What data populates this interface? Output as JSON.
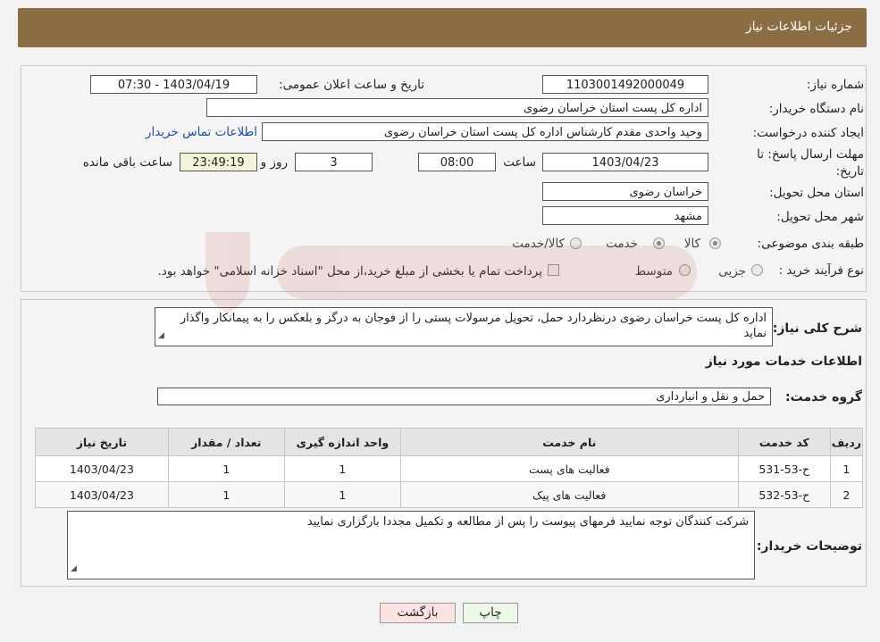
{
  "header": {
    "title": "جزئیات اطلاعات نیاز"
  },
  "form": {
    "need_number_label": "شماره نیاز:",
    "need_number": "1103001492000049",
    "announce_label": "تاریخ و ساعت اعلان عمومی:",
    "announce_value": "1403/04/19 - 07:30",
    "buyer_label": "نام دستگاه خریدار:",
    "buyer_value": "اداره کل پست استان خراسان رضوی",
    "creator_label": "ایجاد کننده درخواست:",
    "creator_value": "وحید واحدی مقدم کارشناس اداره کل پست استان خراسان رضوی",
    "contact_link": "اطلاعات تماس خریدار",
    "deadline_label_1": "مهلت ارسال پاسخ: تا",
    "deadline_label_2": "تاریخ:",
    "deadline_date": "1403/04/23",
    "time_label": "ساعت",
    "deadline_time": "08:00",
    "days_value": "3",
    "days_label": "روز و",
    "remaining_value": "23:49:19",
    "remaining_label": "ساعت باقی مانده",
    "province_label": "استان محل تحویل:",
    "province_value": "خراسان رضوی",
    "city_label": "شهر محل تحویل:",
    "city_value": "مشهد",
    "category_label": "طبقه بندی موضوعی:",
    "category_options": [
      "کالا",
      "خدمت",
      "کالا/خدمت"
    ],
    "purchase_label": "نوع فرآیند خرید :",
    "purchase_options": [
      "جزیی",
      "متوسط"
    ],
    "purchase_note": "پرداخت تمام یا بخشی از مبلغ خرید،از محل \"اسناد خزانه اسلامی\" خواهد بود."
  },
  "description": {
    "label": "شرح کلی نیاز:",
    "text": "اداره کل پست خراسان رضوی درنظردارد حمل، تحویل مرسولات پستی را از فوجان به درگز و بلعکس را به پیمانکار واگذار نماید"
  },
  "services": {
    "section_title": "اطلاعات خدمات مورد نیاز",
    "group_label": "گروه خدمت:",
    "group_value": "حمل و نقل و انبارداری",
    "columns": [
      "ردیف",
      "کد خدمت",
      "نام خدمت",
      "واحد اندازه گیری",
      "تعداد / مقدار",
      "تاریخ نیاز"
    ],
    "rows": [
      [
        "1",
        "ح-53-531",
        "فعالیت های پست",
        "1",
        "1",
        "1403/04/23"
      ],
      [
        "2",
        "ح-53-532",
        "فعالیت های پیک",
        "1",
        "1",
        "1403/04/23"
      ]
    ]
  },
  "buyer_notes": {
    "label": "توضیحات خریدار:",
    "text": "شرکت کنندگان توجه نمایید فرمهای پیوست را پس از مطالعه و تکمیل مجددا بارگزاری نمایید"
  },
  "buttons": {
    "print": "چاپ",
    "back": "بازگشت"
  },
  "colors": {
    "header": "#8b6d43",
    "link": "#1a4fb5",
    "print_bg": "#eef8e8",
    "back_bg": "#fbe3e3"
  }
}
